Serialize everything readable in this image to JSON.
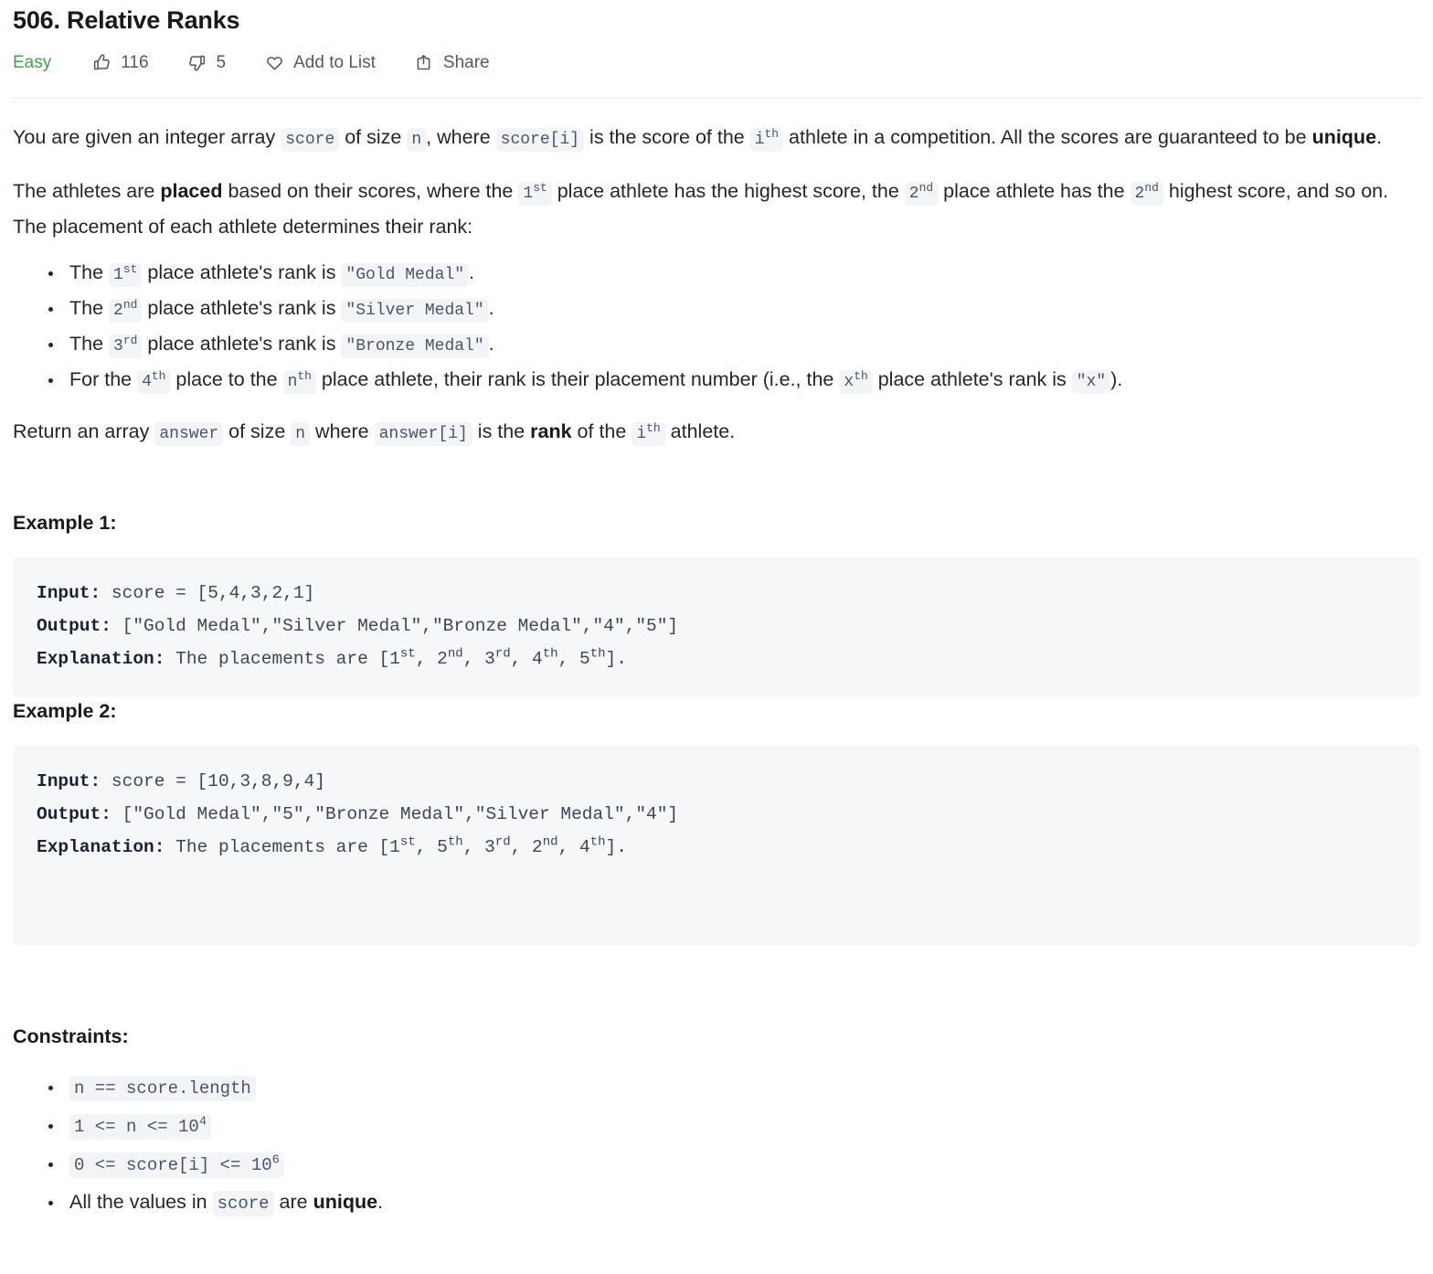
{
  "header": {
    "title": "506. Relative Ranks",
    "difficulty": "Easy",
    "difficulty_color": "#3fa54a",
    "likes_count": "116",
    "dislikes_count": "5",
    "add_to_list_label": "Add to List",
    "share_label": "Share",
    "icons": {
      "like": "thumbs-up-icon",
      "dislike": "thumbs-down-icon",
      "add_to_list": "heart-icon",
      "share": "share-icon"
    }
  },
  "description": {
    "p1": {
      "t1": "You are given an integer array ",
      "c1": "score",
      "t2": " of size ",
      "c2": "n",
      "t3": ", where ",
      "c3": "score[i]",
      "t4": " is the score of the ",
      "c4_base": "i",
      "c4_sup": "th",
      "t5": " athlete in a competition. All the scores are guaranteed to be ",
      "b1": "unique",
      "t6": "."
    },
    "p2": {
      "t1": "The athletes are ",
      "b1": "placed",
      "t2": " based on their scores, where the ",
      "c1_base": "1",
      "c1_sup": "st",
      "t3": " place athlete has the highest score, the ",
      "c2_base": "2",
      "c2_sup": "nd",
      "t4": " place athlete has the ",
      "c3_base": "2",
      "c3_sup": "nd",
      "t5": " highest score, and so on. The placement of each athlete determines their rank:"
    },
    "bullets": [
      {
        "t1": "The ",
        "c1_base": "1",
        "c1_sup": "st",
        "t2": " place athlete's rank is ",
        "c2": "\"Gold Medal\"",
        "t3": "."
      },
      {
        "t1": "The ",
        "c1_base": "2",
        "c1_sup": "nd",
        "t2": " place athlete's rank is ",
        "c2": "\"Silver Medal\"",
        "t3": "."
      },
      {
        "t1": "The ",
        "c1_base": "3",
        "c1_sup": "rd",
        "t2": " place athlete's rank is ",
        "c2": "\"Bronze Medal\"",
        "t3": "."
      }
    ],
    "bullet4": {
      "t1": "For the ",
      "c1_base": "4",
      "c1_sup": "th",
      "t2": " place to the ",
      "c2_base": "n",
      "c2_sup": "th",
      "t3": " place athlete, their rank is their placement number (i.e., the ",
      "c3_base": "x",
      "c3_sup": "th",
      "t4": " place athlete's rank is ",
      "c4": "\"x\"",
      "t5": ")."
    },
    "p3": {
      "t1": "Return an array ",
      "c1": "answer",
      "t2": " of size ",
      "c2": "n",
      "t3": " where ",
      "c3": "answer[i]",
      "t4": " is the ",
      "b1": "rank",
      "t5": " of the ",
      "c4_base": "i",
      "c4_sup": "th",
      "t6": " athlete."
    }
  },
  "examples": [
    {
      "heading": "Example 1:",
      "input_label": "Input:",
      "input_value": " score = [5,4,3,2,1]",
      "output_label": "Output:",
      "output_value": " [\"Gold Medal\",\"Silver Medal\",\"Bronze Medal\",\"4\",\"5\"]",
      "explanation_label": "Explanation:",
      "explanation_prefix": " The placements are [1",
      "sup1": "st",
      "seg2": ", 2",
      "sup2": "nd",
      "seg3": ", 3",
      "sup3": "rd",
      "seg4": ", 4",
      "sup4": "th",
      "seg5": ", 5",
      "sup5": "th",
      "seg6": "]."
    },
    {
      "heading": "Example 2:",
      "input_label": "Input:",
      "input_value": " score = [10,3,8,9,4]",
      "output_label": "Output:",
      "output_value": " [\"Gold Medal\",\"5\",\"Bronze Medal\",\"Silver Medal\",\"4\"]",
      "explanation_label": "Explanation:",
      "explanation_prefix": " The placements are [1",
      "sup1": "st",
      "seg2": ", 5",
      "sup2": "th",
      "seg3": ", 3",
      "sup3": "rd",
      "seg4": ", 2",
      "sup4": "nd",
      "seg5": ", 4",
      "sup5": "th",
      "seg6": "]."
    }
  ],
  "constraints": {
    "heading": "Constraints:",
    "items": [
      {
        "kind": "code",
        "code": "n == score.length"
      },
      {
        "kind": "code_sup",
        "code_base": "1 <= n <= 10",
        "code_sup": "4"
      },
      {
        "kind": "code_sup",
        "code_base": "0 <= score[i] <= 10",
        "code_sup": "6"
      },
      {
        "kind": "mixed",
        "t1": "All the values in ",
        "c1": "score",
        "t2": " are ",
        "b1": "unique",
        "t3": "."
      }
    ]
  }
}
